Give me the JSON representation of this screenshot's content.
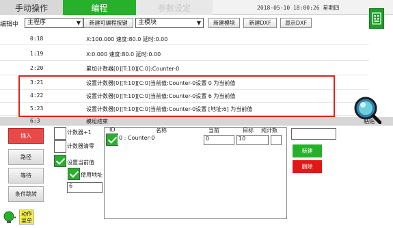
{
  "tabs": {
    "manual": "手动操作",
    "program": "编程",
    "params": "参数设定"
  },
  "datetime": "2018-05-10  18:00:26  星期四",
  "toolbar": {
    "label": "编辑中",
    "program_select": "主程序",
    "new_key_label": "新建可编程按键",
    "module_select": "主模块",
    "new_module": "新建模块",
    "new_dxf": "新建DXF",
    "show_dxf": "显示DXF"
  },
  "program_lines": [
    {
      "num": "0:18",
      "text": "X:100.000 速度:80.0 延时:0.00"
    },
    {
      "num": "1:19",
      "text": "X:0.000 速度:80.0 延时:0.00"
    },
    {
      "num": "2:20",
      "text": "累加计数器[0][T:10][C:0]:Counter-0"
    },
    {
      "num": "3:21",
      "text": "设置计数器[0][T:10][C:0]当前值:Counter-0设置 0 为当前值"
    },
    {
      "num": "4:22",
      "text": "设置计数器[0][T:10][C:0]当前值:Counter-0设置 6 为当前值"
    },
    {
      "num": "5:23",
      "text": "设置计数器[0][T:10][C:0]当前值:Counter-0设置 [地址:6] 为当前值"
    },
    {
      "num": "6:3",
      "text": "模组结束"
    }
  ],
  "side_label": "粘贴",
  "left_buttons": {
    "insert": "插入",
    "path": "路径",
    "wait": "等待",
    "cond_jump": "条件跳转"
  },
  "counter_opts": {
    "add": "计数器+1",
    "clear": "计数器清零",
    "set_current": "设置当前值",
    "use_addr": "使用地址",
    "value": "6"
  },
  "counter_table": {
    "headers": [
      "ID",
      "名称",
      "当前",
      "目标",
      "纯计数"
    ],
    "row": {
      "name": "0 : Counter-0",
      "current": "0",
      "target": "10",
      "pure": ""
    }
  },
  "right_buttons": {
    "new": "新建",
    "delete": "删除"
  },
  "action_menu": "动作菜单",
  "colors": {
    "green": "#27b12b",
    "red": "#e0231b",
    "highlight_border": "#e0231b",
    "delete_btn": "#e01818"
  }
}
